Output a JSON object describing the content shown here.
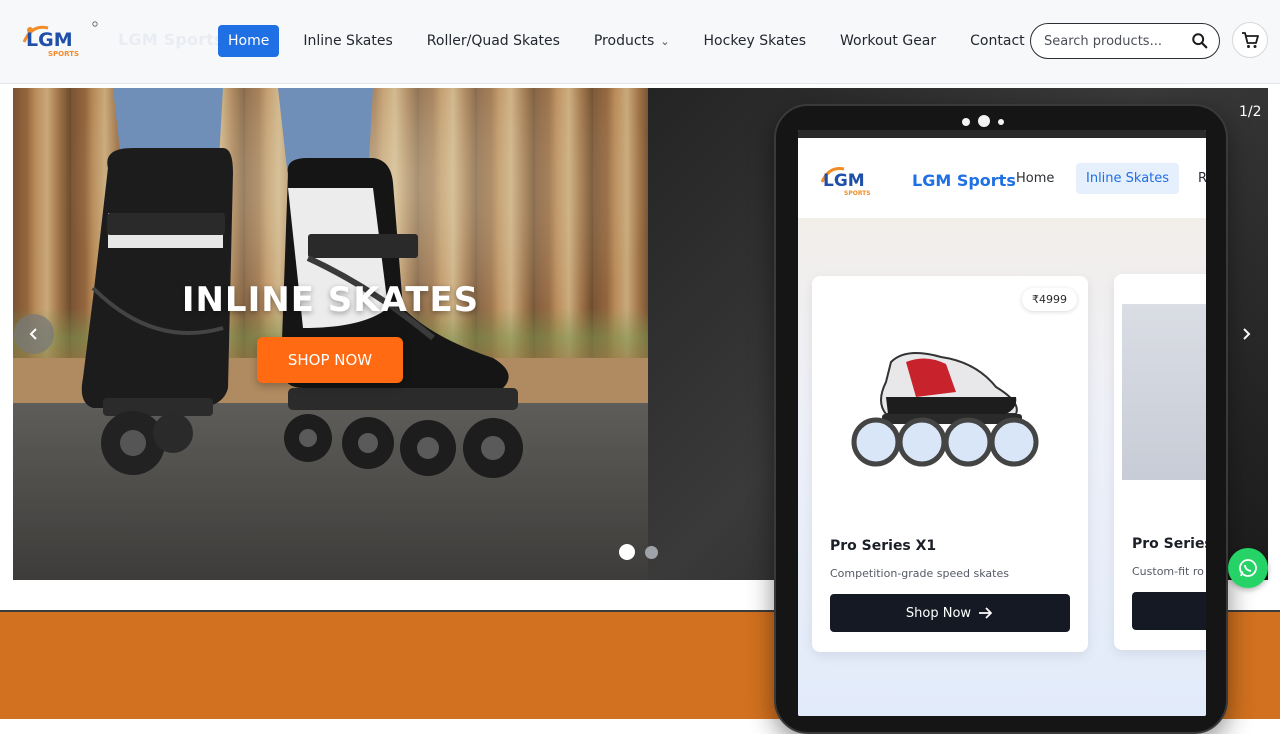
{
  "header": {
    "logo_text": "LGM",
    "logo_sub": "SPORTS",
    "brand_name": "LGM Sports",
    "nav": [
      {
        "label": "Home",
        "active": true
      },
      {
        "label": "Inline Skates",
        "active": false
      },
      {
        "label": "Roller/Quad Skates",
        "active": false
      },
      {
        "label": "Products",
        "active": false,
        "has_dropdown": true
      },
      {
        "label": "Hockey Skates",
        "active": false
      },
      {
        "label": "Workout Gear",
        "active": false
      },
      {
        "label": "Contact",
        "active": false
      }
    ],
    "search_placeholder": "Search products...",
    "icons": {
      "search": "search-icon",
      "cart": "cart-icon",
      "dropdown": "chevron-down-icon"
    }
  },
  "hero": {
    "title": "INLINE SKATES",
    "button_label": "SHOP NOW",
    "slide_counter": "1/2",
    "dots": 2,
    "active_dot": 0
  },
  "tablet": {
    "brand_name": "LGM Sports",
    "logo_text": "LGM",
    "logo_sub": "SPORTS",
    "nav": [
      "Home",
      "Inline Skates",
      "R"
    ],
    "active_nav": "Inline Skates",
    "cards": [
      {
        "price": "₹4999",
        "title": "Pro Series X1",
        "desc": "Competition-grade speed skates",
        "button": "Shop Now"
      },
      {
        "title": "Pro Series",
        "desc": "Custom-fit ro"
      }
    ]
  },
  "colors": {
    "primary_blue": "#1f6fe5",
    "accent_orange": "#ff6a13",
    "band_orange": "#d2711f",
    "dark_button": "#141923",
    "whatsapp_green": "#25d366"
  }
}
